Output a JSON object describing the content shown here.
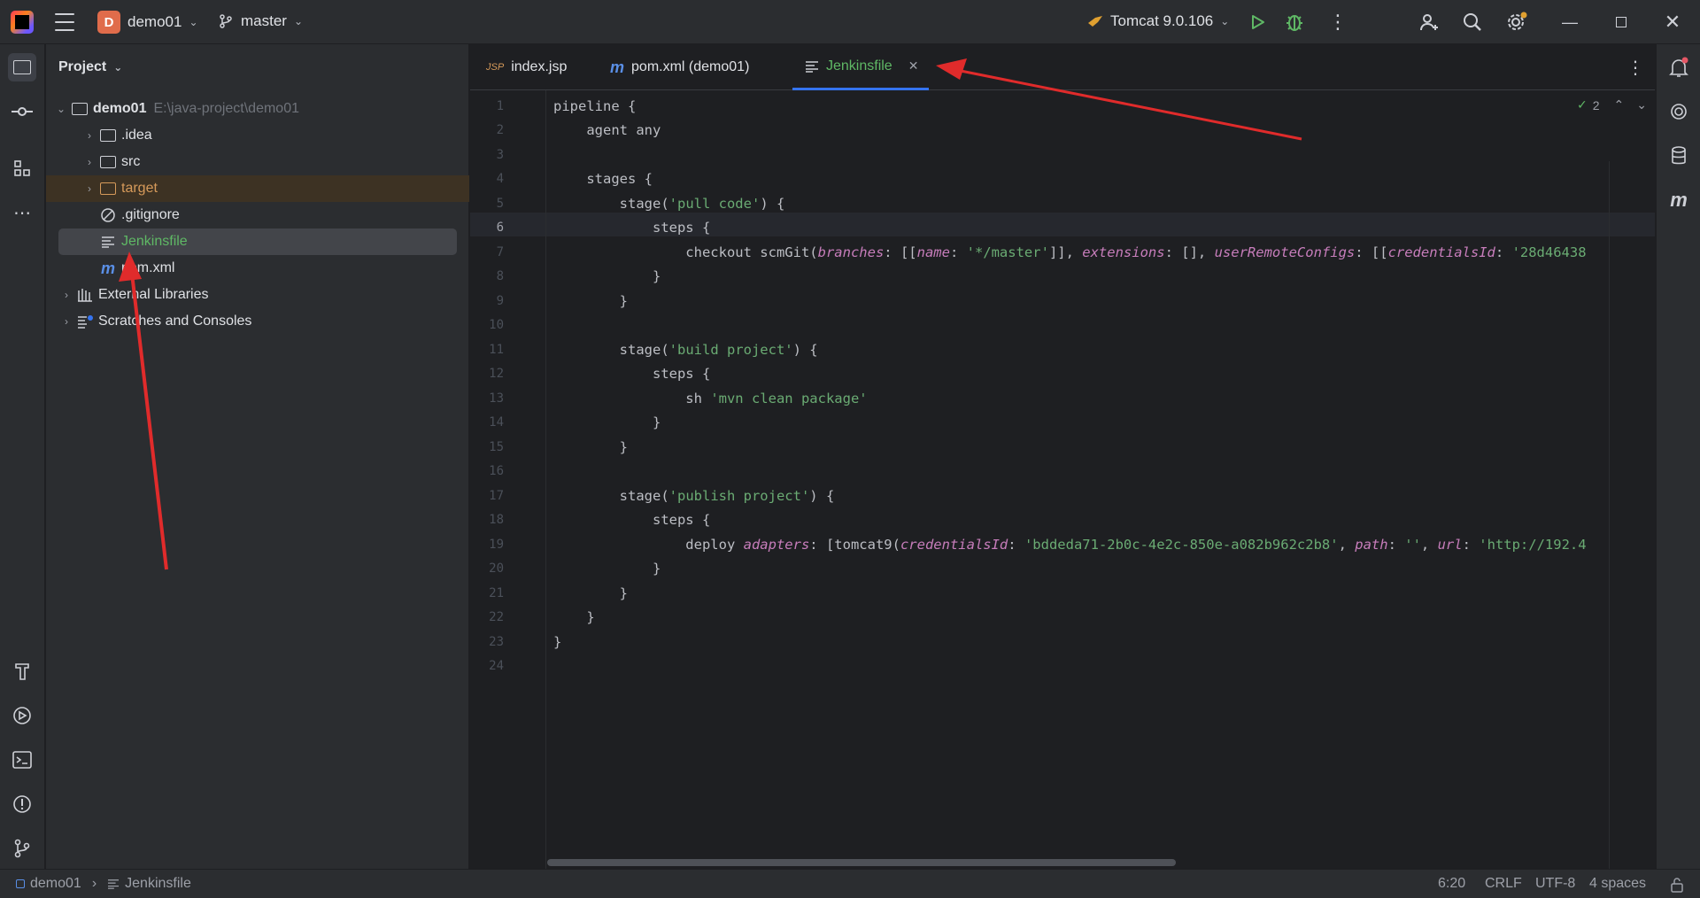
{
  "titlebar": {
    "project_initial": "D",
    "project_name": "demo01",
    "branch": "master",
    "run_config": "Tomcat 9.0.106"
  },
  "project_panel": {
    "title": "Project",
    "tree": [
      {
        "label": "demo01",
        "path": "E:\\java-project\\demo01"
      },
      {
        "label": ".idea"
      },
      {
        "label": "src"
      },
      {
        "label": "target"
      },
      {
        "label": ".gitignore"
      },
      {
        "label": "Jenkinsfile"
      },
      {
        "label": "pom.xml"
      },
      {
        "label": "External Libraries"
      },
      {
        "label": "Scratches and Consoles"
      }
    ]
  },
  "tabs": [
    {
      "icon": "JSP",
      "label": "index.jsp"
    },
    {
      "icon": "m",
      "label": "pom.xml (demo01)"
    },
    {
      "label": "Jenkinsfile"
    }
  ],
  "inspections": {
    "count": "2"
  },
  "code_lines": [
    "1",
    "2",
    "3",
    "4",
    "5",
    "6",
    "7",
    "8",
    "9",
    "10",
    "11",
    "12",
    "13",
    "14",
    "15",
    "16",
    "17",
    "18",
    "19",
    "20",
    "21",
    "22",
    "23",
    "24"
  ],
  "statusbar": {
    "crumb_project": "demo01",
    "crumb_file": "Jenkinsfile",
    "position": "6:20",
    "line_sep": "CRLF",
    "encoding": "UTF-8",
    "indent": "4 spaces"
  },
  "colors": {
    "accent": "#3574f0",
    "annotation": "#e02b2b",
    "string": "#6aab73",
    "named_arg": "#c77dbb"
  }
}
